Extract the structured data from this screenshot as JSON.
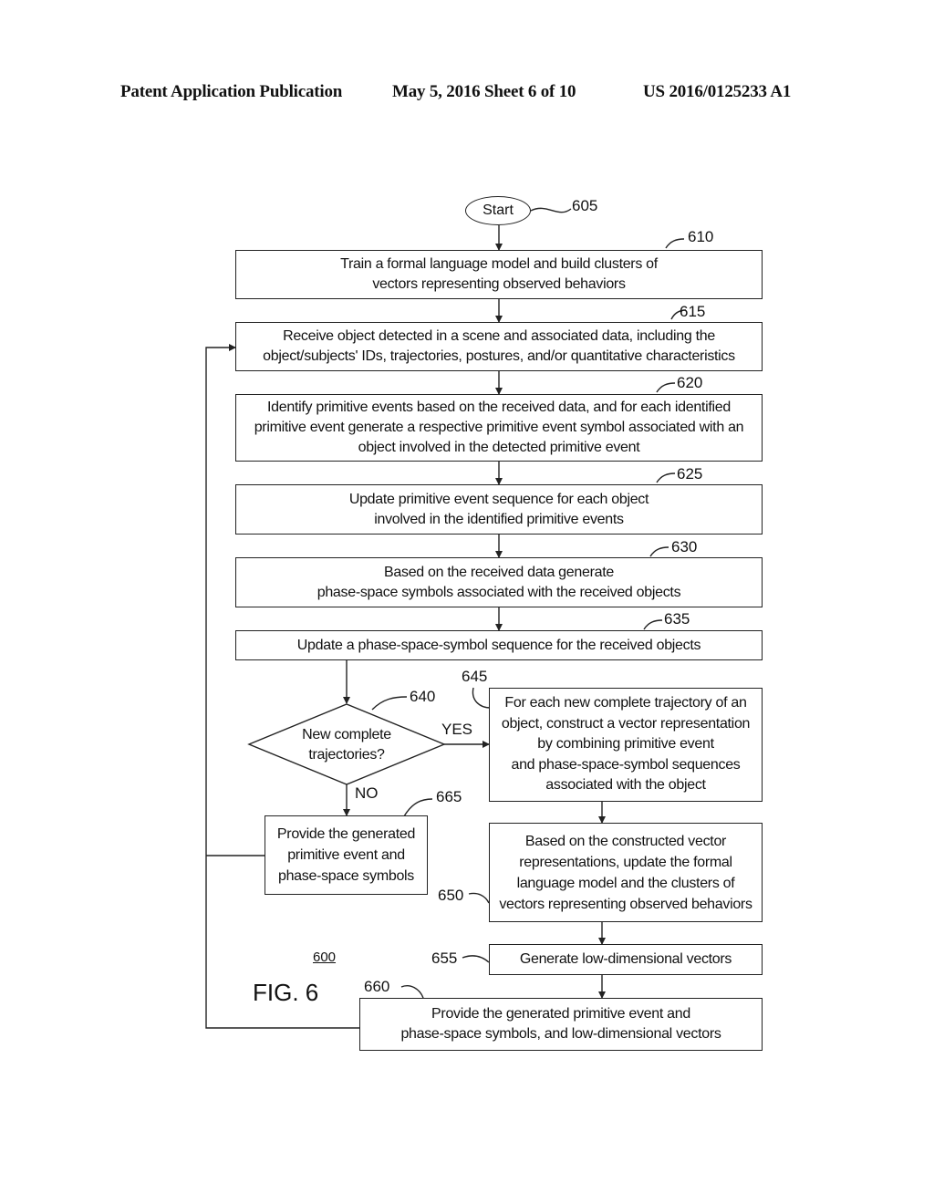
{
  "header": {
    "publication": "Patent Application Publication",
    "date_sheet": "May 5, 2016   Sheet 6 of 10",
    "number": "US 2016/0125233 A1"
  },
  "figure": {
    "label": "FIG. 6",
    "number": "600"
  },
  "start": {
    "label": "Start",
    "ref": "605"
  },
  "steps": [
    {
      "ref": "610",
      "text": "Train a formal language model and build clusters of\nvectors representing observed behaviors"
    },
    {
      "ref": "615",
      "text": "Receive object detected in a scene and associated data, including the\nobject/subjects' IDs, trajectories, postures, and/or quantitative characteristics"
    },
    {
      "ref": "620",
      "text": "Identify primitive events based on the received data, and for each identified\nprimitive event generate a respective primitive event symbol associated with an\nobject involved in the detected primitive event"
    },
    {
      "ref": "625",
      "text": "Update primitive event sequence for each object\ninvolved in the identified primitive events"
    },
    {
      "ref": "630",
      "text": "Based on the received data generate\nphase-space symbols associated with the received objects"
    },
    {
      "ref": "635",
      "text": "Update a phase-space-symbol sequence for the received objects"
    },
    {
      "ref": "645",
      "text": "For each new complete trajectory of an\nobject, construct a vector representation\nby combining primitive event\nand phase-space-symbol sequences\nassociated with the object"
    },
    {
      "ref": "650",
      "text": "Based on the constructed vector\nrepresentations, update the formal\nlanguage model and the clusters of\nvectors representing observed behaviors"
    },
    {
      "ref": "655",
      "text": "Generate low-dimensional vectors"
    },
    {
      "ref": "660",
      "text": "Provide the generated primitive event and\nphase-space symbols, and low-dimensional vectors"
    },
    {
      "ref": "665",
      "text": "Provide the generated\nprimitive event and\nphase-space symbols"
    }
  ],
  "decision": {
    "ref": "640",
    "text": "New complete\ntrajectories?",
    "yes_label": "YES",
    "no_label": "NO"
  }
}
